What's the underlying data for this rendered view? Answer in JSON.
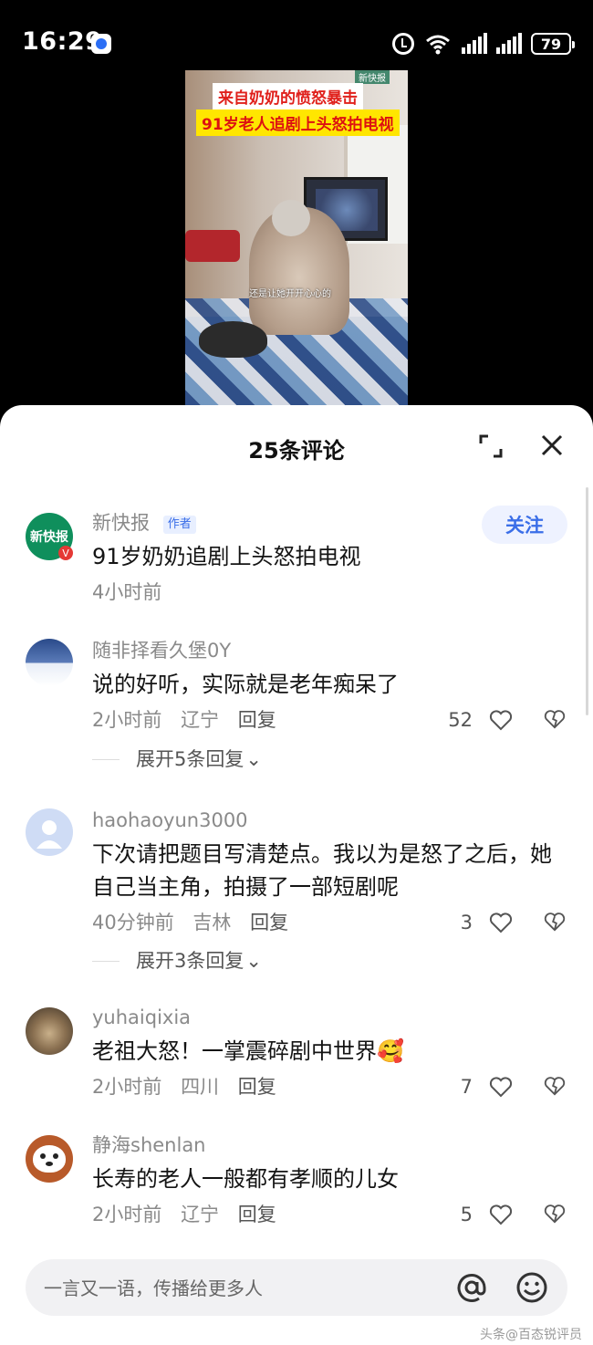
{
  "status_bar": {
    "time": "16:29",
    "battery": "79",
    "network": "6"
  },
  "video": {
    "caption_top": "来自奶奶的愤怒暴击",
    "caption_bottom": "91岁老人追剧上头怒拍电视",
    "logo": "新快报",
    "subtitle": "还是让她开开心心的"
  },
  "sheet": {
    "title": "25条评论"
  },
  "comments": [
    {
      "name": "新快报",
      "author_tag": "作者",
      "avatar_text": "新快报",
      "text": "91岁奶奶追剧上头怒拍电视",
      "time": "4小时前",
      "follow_label": "关注"
    },
    {
      "name": "随非择看久堡0Y",
      "text": "说的好听，实际就是老年痴呆了",
      "time": "2小时前",
      "location": "辽宁",
      "reply_label": "回复",
      "likes": "52",
      "expand_label": "展开5条回复"
    },
    {
      "name": "haohaoyun3000",
      "text": "下次请把题目写清楚点。我以为是怒了之后，她自己当主角，拍摄了一部短剧呢",
      "time": "40分钟前",
      "location": "吉林",
      "reply_label": "回复",
      "likes": "3",
      "expand_label": "展开3条回复"
    },
    {
      "name": "yuhaiqixia",
      "text": "老祖大怒！一掌震碎剧中世界🥰",
      "time": "2小时前",
      "location": "四川",
      "reply_label": "回复",
      "likes": "7"
    },
    {
      "name": "静海shenlan",
      "text": "长寿的老人一般都有孝顺的儿女",
      "time": "2小时前",
      "location": "辽宁",
      "reply_label": "回复",
      "likes": "5"
    }
  ],
  "input": {
    "placeholder": "一言又一语，传播给更多人"
  },
  "watermark": "头条@百态锐评员"
}
